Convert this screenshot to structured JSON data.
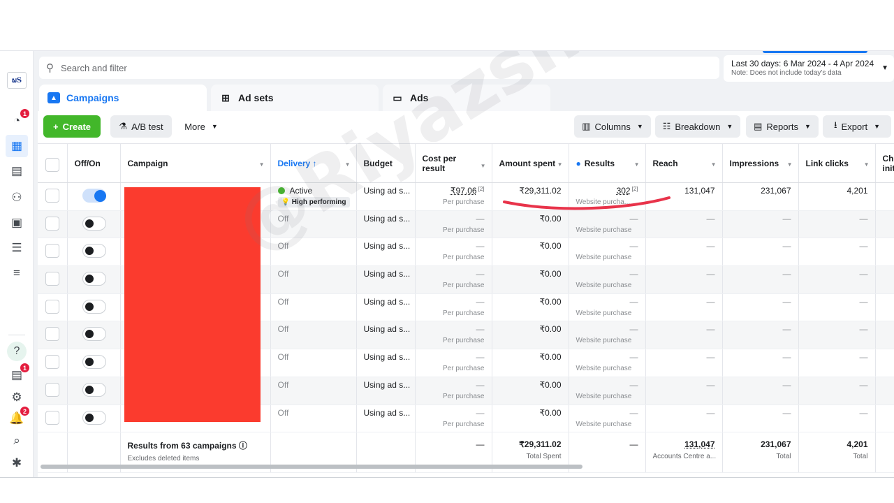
{
  "rail": {
    "logo_text": "ພS",
    "icons": [
      {
        "name": "overview-icon",
        "glyph": "◔",
        "badge": "1"
      },
      {
        "name": "campaigns-table-icon",
        "glyph": "▦",
        "active": true
      },
      {
        "name": "reports-icon",
        "glyph": "▤"
      },
      {
        "name": "audiences-icon",
        "glyph": "⚇"
      },
      {
        "name": "creative-icon",
        "glyph": "▣"
      },
      {
        "name": "billing-icon",
        "glyph": "☰"
      },
      {
        "name": "menu-icon",
        "glyph": "≡"
      }
    ],
    "bottom_icons": [
      {
        "name": "help-icon",
        "glyph": "?"
      },
      {
        "name": "notifications-doc-icon",
        "glyph": "▤",
        "badge": "1"
      },
      {
        "name": "settings-icon",
        "glyph": "⚙"
      },
      {
        "name": "bell-icon",
        "glyph": "🔔",
        "badge": "2"
      },
      {
        "name": "search-icon",
        "glyph": "⌕"
      },
      {
        "name": "bug-icon",
        "glyph": "✱"
      }
    ]
  },
  "search": {
    "placeholder": "Search and filter"
  },
  "date_range": {
    "label": "Last 30 days: 6 Mar 2024 - 4 Apr 2024",
    "note": "Note: Does not include today's data"
  },
  "tabs": [
    {
      "label": "Campaigns",
      "active": true
    },
    {
      "label": "Ad sets",
      "active": false
    },
    {
      "label": "Ads",
      "active": false
    }
  ],
  "toolbar": {
    "create": "Create",
    "ab_test": "A/B test",
    "more": "More",
    "columns": "Columns",
    "breakdown": "Breakdown",
    "reports": "Reports",
    "export": "Export"
  },
  "columns": {
    "offon": "Off/On",
    "campaign": "Campaign",
    "delivery": "Delivery ↑",
    "budget": "Budget",
    "cost_per_result": "Cost per result",
    "amount_spent": "Amount spent",
    "results": "Results",
    "reach": "Reach",
    "impressions": "Impressions",
    "link_clicks": "Link clicks",
    "checkouts": "Checkouts initiated"
  },
  "rows": [
    {
      "on": true,
      "delivery": "Active",
      "badge": "High performing",
      "budget": "Using ad s...",
      "cost": "₹97.06",
      "cost_fn": "[2]",
      "cost_sub": "Per purchase",
      "spent": "₹29,311.02",
      "results": "302",
      "results_fn": "[2]",
      "results_sub": "Website purcha...",
      "reach": "131,047",
      "impressions": "231,067",
      "clicks": "4,201"
    },
    {
      "on": false,
      "delivery": "Off",
      "budget": "Using ad s...",
      "cost": "—",
      "cost_sub": "Per purchase",
      "spent": "₹0.00",
      "results": "—",
      "results_sub": "Website purchase",
      "reach": "—",
      "impressions": "—",
      "clicks": "—"
    },
    {
      "on": false,
      "delivery": "Off",
      "budget": "Using ad s...",
      "cost": "—",
      "cost_sub": "Per purchase",
      "spent": "₹0.00",
      "results": "—",
      "results_sub": "Website purchase",
      "reach": "—",
      "impressions": "—",
      "clicks": "—"
    },
    {
      "on": false,
      "delivery": "Off",
      "budget": "Using ad s...",
      "cost": "—",
      "cost_sub": "Per purchase",
      "spent": "₹0.00",
      "results": "—",
      "results_sub": "Website purchase",
      "reach": "—",
      "impressions": "—",
      "clicks": "—"
    },
    {
      "on": false,
      "delivery": "Off",
      "budget": "Using ad s...",
      "cost": "—",
      "cost_sub": "Per purchase",
      "spent": "₹0.00",
      "results": "—",
      "results_sub": "Website purchase",
      "reach": "—",
      "impressions": "—",
      "clicks": "—"
    },
    {
      "on": false,
      "delivery": "Off",
      "budget": "Using ad s...",
      "cost": "—",
      "cost_sub": "Per purchase",
      "spent": "₹0.00",
      "results": "—",
      "results_sub": "Website purchase",
      "reach": "—",
      "impressions": "—",
      "clicks": "—"
    },
    {
      "on": false,
      "delivery": "Off",
      "budget": "Using ad s...",
      "cost": "—",
      "cost_sub": "Per purchase",
      "spent": "₹0.00",
      "results": "—",
      "results_sub": "Website purchase",
      "reach": "—",
      "impressions": "—",
      "clicks": "—"
    },
    {
      "on": false,
      "delivery": "Off",
      "budget": "Using ad s...",
      "cost": "—",
      "cost_sub": "Per purchase",
      "spent": "₹0.00",
      "results": "—",
      "results_sub": "Website purchase",
      "reach": "—",
      "impressions": "—",
      "clicks": "—"
    },
    {
      "on": false,
      "delivery": "Off",
      "budget": "Using ad s...",
      "cost": "—",
      "cost_sub": "Per purchase",
      "spent": "₹0.00",
      "results": "—",
      "results_sub": "Website purchase",
      "reach": "—",
      "impressions": "—",
      "clicks": "—"
    }
  ],
  "footer": {
    "title": "Results from 63 campaigns",
    "subtitle": "Excludes deleted items",
    "cost": "—",
    "spent": "₹29,311.02",
    "spent_sub": "Total Spent",
    "results": "—",
    "reach": "131,047",
    "reach_sub": "Accounts Centre a...",
    "impressions": "231,067",
    "impressions_sub": "Total",
    "clicks": "4,201",
    "clicks_sub": "Total"
  },
  "watermark": "@Riyazshaikh",
  "colors": {
    "accent": "#1877f2",
    "create": "#42b72a",
    "redaction": "#fb3b2e",
    "annotation": "#e8334a"
  }
}
